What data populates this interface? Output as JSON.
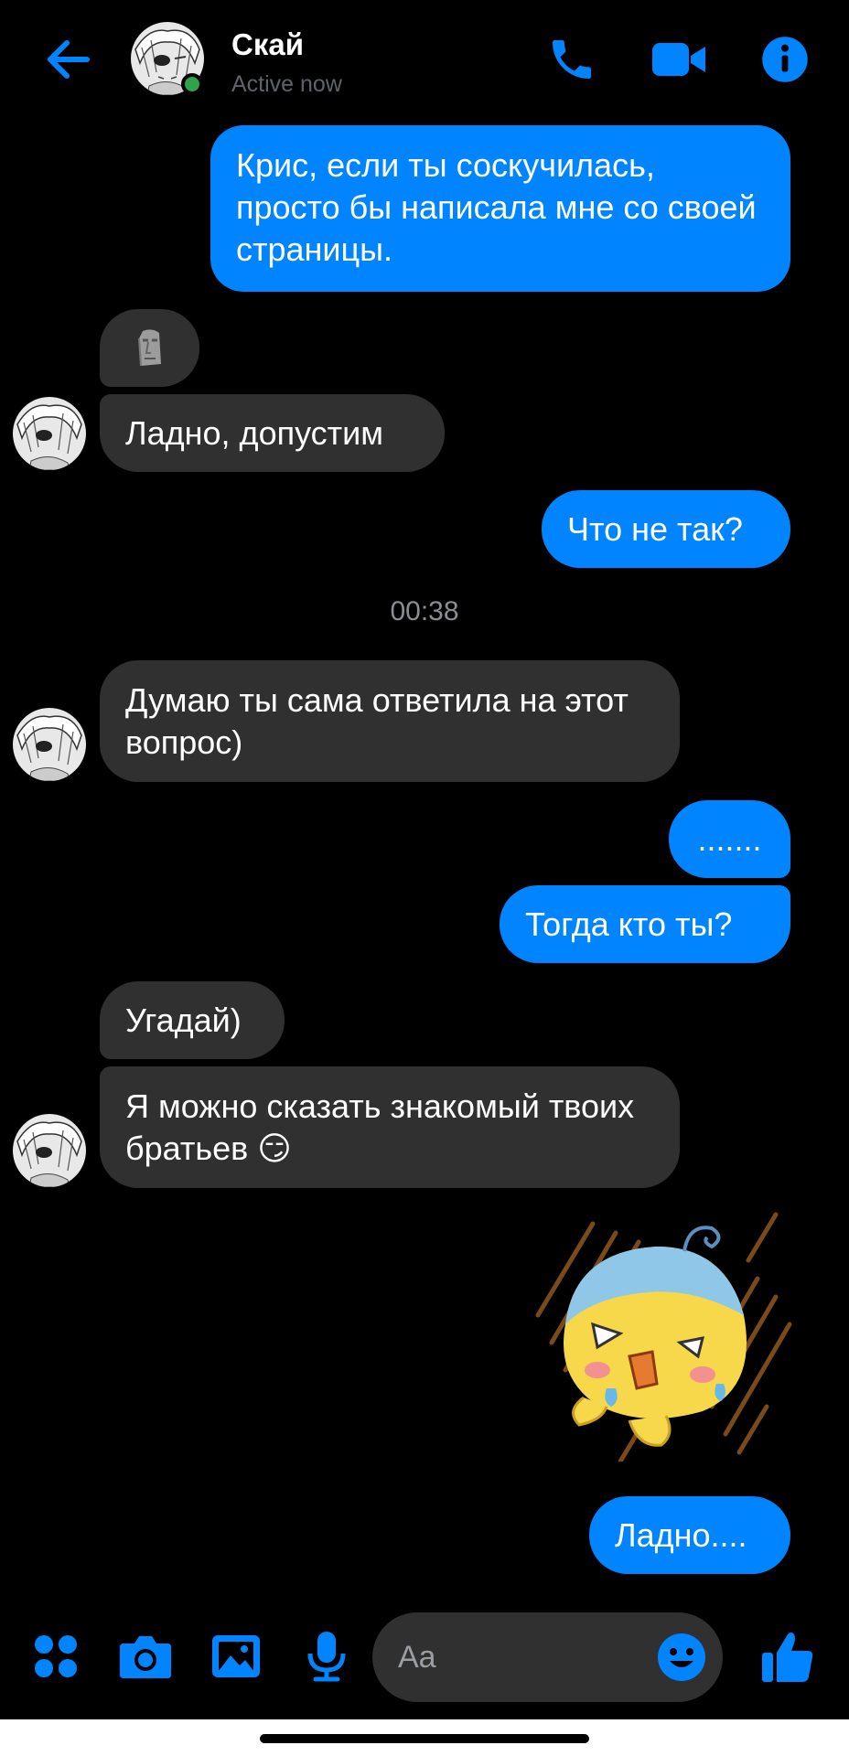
{
  "header": {
    "contact_name": "Скай",
    "status": "Active now"
  },
  "messages": [
    {
      "dir": "out",
      "text": "Крис, если ты соскучилась, просто бы написала мне со своей страницы."
    },
    {
      "dir": "in",
      "type": "emoji",
      "icon": "moai-emoji"
    },
    {
      "dir": "in",
      "text": "Ладно, допустим"
    },
    {
      "dir": "out",
      "text": "Что не так?"
    },
    {
      "dir": "in",
      "text": "Думаю ты сама ответила на этот вопрос)"
    },
    {
      "dir": "out",
      "text": "......."
    },
    {
      "dir": "out",
      "text": "Тогда кто ты?"
    },
    {
      "dir": "in",
      "text": "Угадай)"
    },
    {
      "dir": "in",
      "text": "Я можно сказать знакомый твоих братьев",
      "emoji": "😏"
    },
    {
      "dir": "out",
      "type": "sticker",
      "icon": "crying-yellow-blob-sticker"
    },
    {
      "dir": "out",
      "text": "Ладно...."
    }
  ],
  "timestamp": "00:38",
  "composer": {
    "placeholder": "Aa"
  },
  "colors": {
    "accent": "#0084ff",
    "incoming_bubble": "#303030",
    "background": "#000000",
    "online": "#31a24c"
  }
}
